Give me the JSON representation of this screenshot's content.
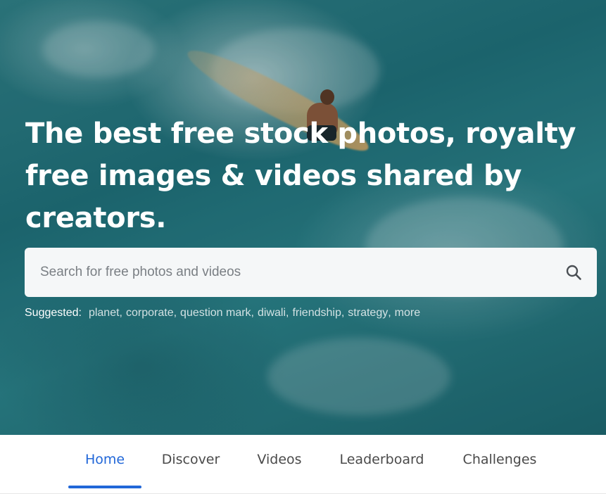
{
  "hero": {
    "headline": "The best free stock photos, royalty free images & videos shared by creators."
  },
  "search": {
    "placeholder": "Search for free photos and videos",
    "icon": "search-icon"
  },
  "suggested": {
    "label": "Suggested:",
    "items": [
      "planet",
      "corporate",
      "question mark",
      "diwali",
      "friendship",
      "strategy",
      "more"
    ]
  },
  "nav": {
    "tabs": [
      {
        "label": "Home",
        "active": true
      },
      {
        "label": "Discover",
        "active": false
      },
      {
        "label": "Videos",
        "active": false
      },
      {
        "label": "Leaderboard",
        "active": false
      },
      {
        "label": "Challenges",
        "active": false
      }
    ],
    "accent_color": "#2167d8"
  }
}
